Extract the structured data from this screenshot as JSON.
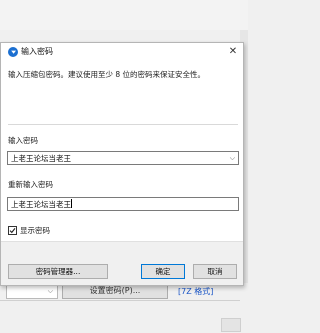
{
  "dialog": {
    "title": "输入密码",
    "instruction": "输入压缩包密码。建议使用至少 8 位的密码来保证安全性。",
    "password_label": "输入密码",
    "password_value": "上老王论坛当老王",
    "confirm_label": "重新输入密码",
    "confirm_value": "上老王论坛当老王",
    "show_password_label": "显示密码",
    "show_password_checked": true,
    "manager_button": "密码管理器...",
    "ok_button": "确定",
    "cancel_button": "取消"
  },
  "background": {
    "set_password_button": "设置密码(P)...",
    "format_link": "[7Z 格式]"
  },
  "colors": {
    "accent": "#0078d7",
    "title_icon": "#1b6fd1",
    "link": "#1a56c8"
  }
}
